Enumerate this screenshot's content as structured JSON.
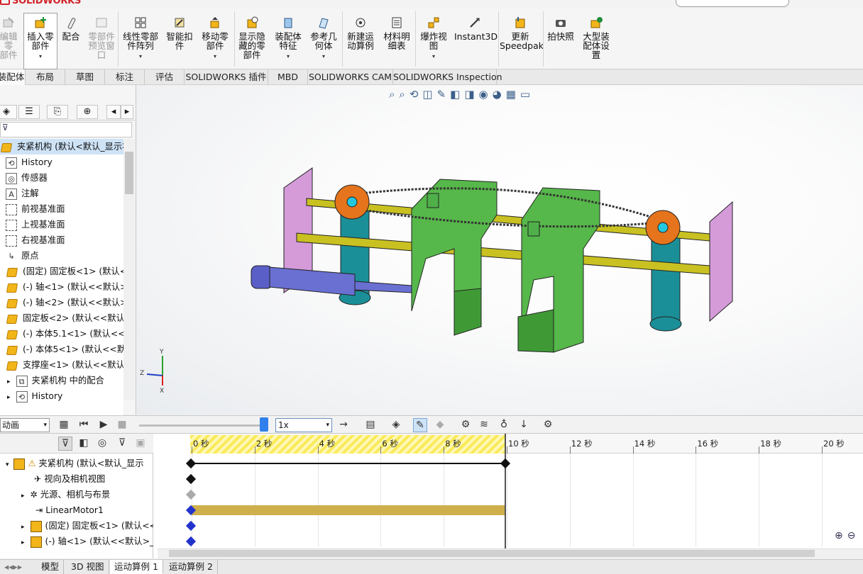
{
  "app": {
    "brand": "SOLIDWORKS"
  },
  "toolbar": {
    "tools": [
      {
        "id": "edit-part",
        "label": "编辑零\n部件",
        "dim": true
      },
      {
        "id": "insert-part",
        "label": "插入零\n部件",
        "dim": false
      },
      {
        "id": "mate",
        "label": "配合",
        "dim": false
      },
      {
        "id": "part-preview",
        "label": "零部件\n预览窗\n口",
        "dim": true
      },
      {
        "id": "linear-pattern",
        "label": "线性零部\n件阵列",
        "dim": false
      },
      {
        "id": "smart-fasteners",
        "label": "智能扣\n件",
        "dim": false
      },
      {
        "id": "move-component",
        "label": "移动零\n部件",
        "dim": false
      },
      {
        "id": "show-hidden",
        "label": "显示隐\n藏的零\n部件",
        "dim": false
      },
      {
        "id": "assembly-features",
        "label": "装配体\n特征",
        "dim": false
      },
      {
        "id": "reference-geometry",
        "label": "参考几\n何体",
        "dim": false
      },
      {
        "id": "new-motion-study",
        "label": "新建运\n动算例",
        "dim": false
      },
      {
        "id": "bom",
        "label": "材料明\n细表",
        "dim": false
      },
      {
        "id": "exploded-view",
        "label": "爆炸视\n图",
        "dim": false
      },
      {
        "id": "instant3d",
        "label": "Instant3D",
        "dim": false
      },
      {
        "id": "update-speedpak",
        "label": "更新\nSpeedpak",
        "dim": false
      },
      {
        "id": "take-snapshot",
        "label": "拍快照",
        "dim": false
      },
      {
        "id": "large-assembly",
        "label": "大型装\n配体设\n置",
        "dim": false
      }
    ]
  },
  "tabs": [
    "装配体",
    "布局",
    "草图",
    "标注",
    "评估",
    "SOLIDWORKS 插件",
    "MBD",
    "SOLIDWORKS CAM",
    "SOLIDWORKS Inspection"
  ],
  "feature_tree": {
    "root": "夹紧机构  (默认<默认_显示状态",
    "items": [
      {
        "label": "History",
        "icon": "history-icon"
      },
      {
        "label": "传感器",
        "icon": "sensor-icon"
      },
      {
        "label": "注解",
        "icon": "annotation-icon"
      },
      {
        "label": "前视基准面",
        "icon": "plane-icon"
      },
      {
        "label": "上视基准面",
        "icon": "plane-icon"
      },
      {
        "label": "右视基准面",
        "icon": "plane-icon"
      },
      {
        "label": "原点",
        "icon": "origin-icon"
      },
      {
        "label": "(固定) 固定板<1> (默认<<",
        "icon": "part-icon"
      },
      {
        "label": "(-) 轴<1> (默认<<默认>_",
        "icon": "part-icon"
      },
      {
        "label": "(-) 轴<2> (默认<<默认>_",
        "icon": "part-icon"
      },
      {
        "label": "固定板<2> (默认<<默认>",
        "icon": "part-icon"
      },
      {
        "label": "(-) 本体5.1<1> (默认<<默",
        "icon": "part-icon"
      },
      {
        "label": "(-) 本体5<1> (默认<<默认",
        "icon": "part-icon"
      },
      {
        "label": "支撑座<1> (默认<<默认>",
        "icon": "part-icon"
      },
      {
        "label": "夹紧机构 中的配合",
        "icon": "mates-icon"
      },
      {
        "label": "History",
        "icon": "history-icon"
      }
    ]
  },
  "motion": {
    "study_type": "动画",
    "speed": "1x",
    "tree": [
      {
        "label": "夹紧机构  (默认<默认_显示",
        "icon": "warning-icon"
      },
      {
        "label": "视向及相机视图",
        "icon": "camera-icon"
      },
      {
        "label": "光源、相机与布景",
        "icon": "light-icon"
      },
      {
        "label": "LinearMotor1",
        "icon": "motor-icon"
      },
      {
        "label": "(固定) 固定板<1> (默认<<",
        "icon": "part-icon"
      },
      {
        "label": "(-) 轴<1> (默认<<默认>_",
        "icon": "part-icon"
      }
    ],
    "ticks": [
      "0 秒",
      "2 秒",
      "4 秒",
      "6 秒",
      "8 秒",
      "10 秒",
      "12 秒",
      "14 秒",
      "16 秒",
      "18 秒",
      "20 秒"
    ],
    "duration_seconds": 10
  },
  "triad": {
    "y": "Y",
    "z": "Z",
    "x": "X"
  },
  "bottom_tabs": [
    "模型",
    "3D 视图",
    "运动算例 1",
    "运动算例 2"
  ],
  "colors": {
    "hatch": "#f9ea5a",
    "motor_bar": "#cfae4c",
    "selection": "#cfe3f7"
  }
}
